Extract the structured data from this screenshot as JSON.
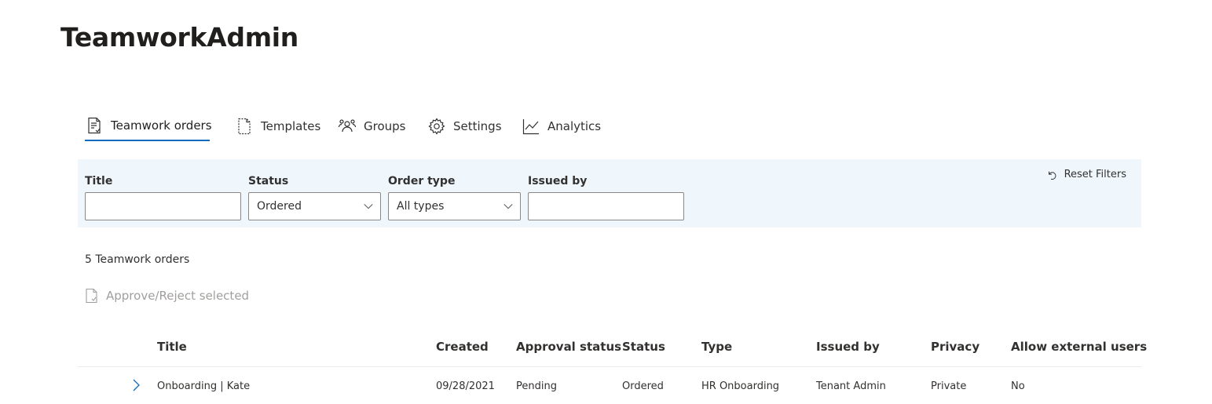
{
  "app": {
    "title": "TeamworkAdmin"
  },
  "tabs": [
    {
      "label": "Teamwork orders",
      "icon": "document-list-icon",
      "active": true
    },
    {
      "label": "Templates",
      "icon": "page-icon",
      "active": false
    },
    {
      "label": "Groups",
      "icon": "people-group-icon",
      "active": false
    },
    {
      "label": "Settings",
      "icon": "gear-icon",
      "active": false
    },
    {
      "label": "Analytics",
      "icon": "line-chart-icon",
      "active": false
    }
  ],
  "filters": {
    "title": {
      "label": "Title",
      "value": ""
    },
    "status": {
      "label": "Status",
      "value": "Ordered"
    },
    "order_type": {
      "label": "Order type",
      "value": "All types"
    },
    "issued_by": {
      "label": "Issued by",
      "value": ""
    },
    "reset_label": "Reset Filters"
  },
  "summary": {
    "count_text": "5 Teamwork orders"
  },
  "actions": {
    "approve_reject_label": "Approve/Reject selected"
  },
  "table": {
    "columns": [
      "Title",
      "Created",
      "Approval status",
      "Status",
      "Type",
      "Issued by",
      "Privacy",
      "Allow external users"
    ],
    "rows": [
      [
        "Onboarding | Kate",
        "09/28/2021",
        "Pending",
        "Ordered",
        "HR Onboarding",
        "Tenant Admin",
        "Private",
        "No"
      ]
    ]
  },
  "colors": {
    "accent": "#0f6cbd",
    "filter_bg": "#eff6fc",
    "disabled_text": "#a19f9d"
  }
}
